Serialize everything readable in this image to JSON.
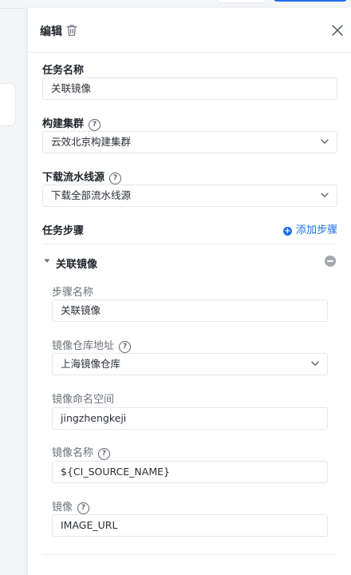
{
  "drawer": {
    "title": "编辑",
    "fields": {
      "task_name": {
        "label": "任务名称",
        "value": "关联镜像"
      },
      "build_cluster": {
        "label": "构建集群",
        "value": "云效北京构建集群"
      },
      "download_pipeline_source": {
        "label": "下载流水线源",
        "value": "下载全部流水线源"
      }
    },
    "steps": {
      "label": "任务步骤",
      "add_label": "添加步骤",
      "items": [
        {
          "title": "关联镜像",
          "fields": {
            "step_name": {
              "label": "步骤名称",
              "value": "关联镜像"
            },
            "repo_address": {
              "label": "镜像仓库地址",
              "value": "上海镜像仓库"
            },
            "namespace": {
              "label": "镜像命名空间",
              "value": "jingzhengkeji"
            },
            "image_name": {
              "label": "镜像名称",
              "value": "${CI_SOURCE_NAME}"
            },
            "image": {
              "label": "镜像",
              "value": "IMAGE_URL"
            }
          }
        }
      ]
    }
  },
  "icons": {
    "delete": "trash-icon",
    "close": "close-icon",
    "help": "question-circle-icon",
    "dropdown": "chevron-down-icon",
    "add": "plus-circle-icon",
    "collapse": "caret-down-icon",
    "remove": "minus-circle-icon"
  },
  "colors": {
    "accent": "#1f6feb",
    "remove_icon": "#a5a8ae"
  }
}
